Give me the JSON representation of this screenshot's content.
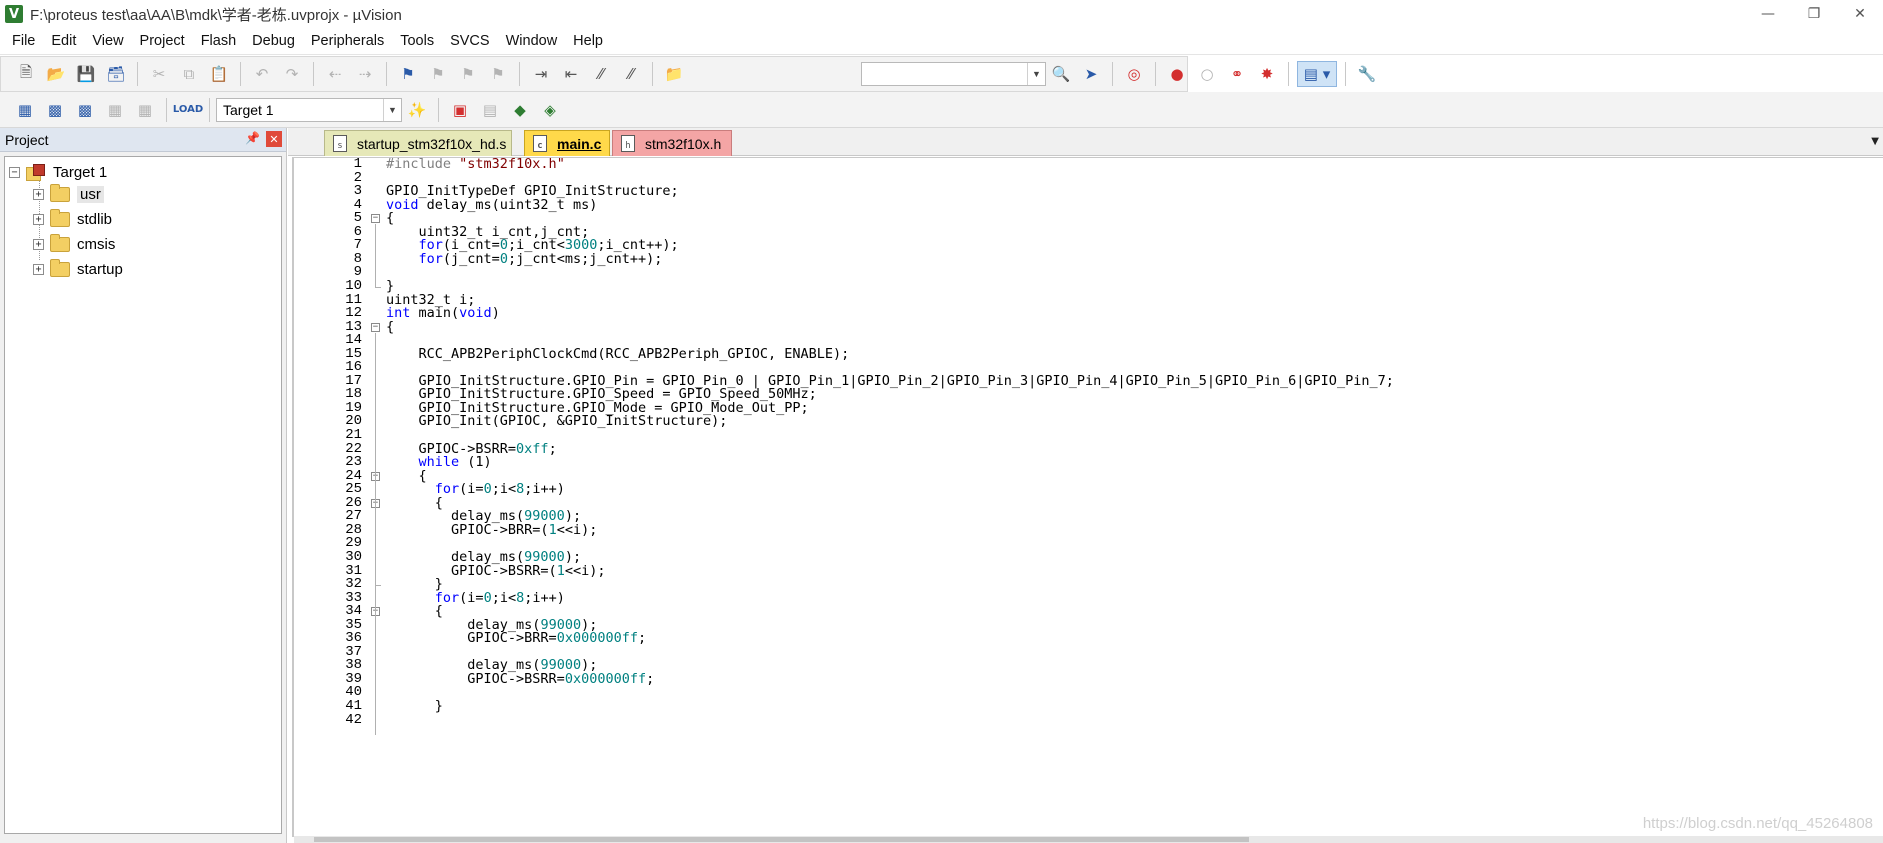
{
  "window": {
    "title": "F:\\proteus test\\aa\\AA\\B\\mdk\\学者-老栋.uvprojx - µVision",
    "app_icon": "V",
    "buttons": [
      "minimize",
      "restore",
      "close"
    ]
  },
  "menu": [
    "File",
    "Edit",
    "View",
    "Project",
    "Flash",
    "Debug",
    "Peripherals",
    "Tools",
    "SVCS",
    "Window",
    "Help"
  ],
  "toolbar": {
    "target_select": "Target 1"
  },
  "project": {
    "header": "Project",
    "target": "Target 1",
    "groups": [
      "usr",
      "stdlib",
      "cmsis",
      "startup"
    ]
  },
  "tabs": [
    {
      "label": "startup_stm32f10x_hd.s",
      "color": "#e6e8b8"
    },
    {
      "label": "main.c",
      "color": "#ffd94a",
      "active": true
    },
    {
      "label": "stm32f10x.h",
      "color": "#f4a5a5"
    }
  ],
  "colors": {
    "keyword": "#0000ff",
    "number": "#008080",
    "string": "#800000",
    "preprocessor": "#808080"
  },
  "code": [
    [
      {
        "t": "#include ",
        "c": "pp"
      },
      {
        "t": "\"stm32f10x.h\"",
        "c": "str"
      }
    ],
    [],
    [
      {
        "t": "GPIO_InitTypeDef GPIO_InitStructure;"
      }
    ],
    [
      {
        "t": "void",
        "c": "kw"
      },
      {
        "t": " delay_ms(uint32_t ms)"
      }
    ],
    [
      {
        "t": "{"
      }
    ],
    [
      {
        "t": "    uint32_t i_cnt,j_cnt;"
      }
    ],
    [
      {
        "t": "    "
      },
      {
        "t": "for",
        "c": "kw"
      },
      {
        "t": "(i_cnt="
      },
      {
        "t": "0",
        "c": "num"
      },
      {
        "t": ";i_cnt<"
      },
      {
        "t": "3000",
        "c": "num"
      },
      {
        "t": ";i_cnt++);"
      }
    ],
    [
      {
        "t": "    "
      },
      {
        "t": "for",
        "c": "kw"
      },
      {
        "t": "(j_cnt="
      },
      {
        "t": "0",
        "c": "num"
      },
      {
        "t": ";j_cnt<ms;j_cnt++);"
      }
    ],
    [],
    [
      {
        "t": "}"
      }
    ],
    [
      {
        "t": "uint32_t i;"
      }
    ],
    [
      {
        "t": "int",
        "c": "kw"
      },
      {
        "t": " main("
      },
      {
        "t": "void",
        "c": "kw"
      },
      {
        "t": ")"
      }
    ],
    [
      {
        "t": "{"
      }
    ],
    [],
    [
      {
        "t": "    RCC_APB2PeriphClockCmd(RCC_APB2Periph_GPIOC, ENABLE);"
      }
    ],
    [],
    [
      {
        "t": "    GPIO_InitStructure.GPIO_Pin = GPIO_Pin_0 | GPIO_Pin_1|GPIO_Pin_2|GPIO_Pin_3|GPIO_Pin_4|GPIO_Pin_5|GPIO_Pin_6|GPIO_Pin_7;"
      }
    ],
    [
      {
        "t": "    GPIO_InitStructure.GPIO_Speed = GPIO_Speed_50MHz;"
      }
    ],
    [
      {
        "t": "    GPIO_InitStructure.GPIO_Mode = GPIO_Mode_Out_PP;"
      }
    ],
    [
      {
        "t": "    GPIO_Init(GPIOC, &GPIO_InitStructure);"
      }
    ],
    [],
    [
      {
        "t": "    GPIOC->BSRR="
      },
      {
        "t": "0xff",
        "c": "num"
      },
      {
        "t": ";"
      }
    ],
    [
      {
        "t": "    "
      },
      {
        "t": "while",
        "c": "kw"
      },
      {
        "t": " (1)"
      }
    ],
    [
      {
        "t": "    {"
      }
    ],
    [
      {
        "t": "      "
      },
      {
        "t": "for",
        "c": "kw"
      },
      {
        "t": "(i="
      },
      {
        "t": "0",
        "c": "num"
      },
      {
        "t": ";i<"
      },
      {
        "t": "8",
        "c": "num"
      },
      {
        "t": ";i++)"
      }
    ],
    [
      {
        "t": "      {"
      }
    ],
    [
      {
        "t": "        delay_ms("
      },
      {
        "t": "99000",
        "c": "num"
      },
      {
        "t": ");"
      }
    ],
    [
      {
        "t": "        GPIOC->BRR=("
      },
      {
        "t": "1",
        "c": "num"
      },
      {
        "t": "<<i);"
      }
    ],
    [],
    [
      {
        "t": "        delay_ms("
      },
      {
        "t": "99000",
        "c": "num"
      },
      {
        "t": ");"
      }
    ],
    [
      {
        "t": "        GPIOC->BSRR=("
      },
      {
        "t": "1",
        "c": "num"
      },
      {
        "t": "<<i);"
      }
    ],
    [
      {
        "t": "      }"
      }
    ],
    [
      {
        "t": "      "
      },
      {
        "t": "for",
        "c": "kw"
      },
      {
        "t": "(i="
      },
      {
        "t": "0",
        "c": "num"
      },
      {
        "t": ";i<"
      },
      {
        "t": "8",
        "c": "num"
      },
      {
        "t": ";i++)"
      }
    ],
    [
      {
        "t": "      {"
      }
    ],
    [
      {
        "t": "          delay_ms("
      },
      {
        "t": "99000",
        "c": "num"
      },
      {
        "t": ");"
      }
    ],
    [
      {
        "t": "          GPIOC->BRR="
      },
      {
        "t": "0x000000ff",
        "c": "num"
      },
      {
        "t": ";"
      }
    ],
    [],
    [
      {
        "t": "          delay_ms("
      },
      {
        "t": "99000",
        "c": "num"
      },
      {
        "t": ");"
      }
    ],
    [
      {
        "t": "          GPIOC->BSRR="
      },
      {
        "t": "0x000000ff",
        "c": "num"
      },
      {
        "t": ";"
      }
    ],
    [],
    [
      {
        "t": "      }"
      }
    ],
    []
  ],
  "fold_markers": [
    5,
    13,
    24,
    26,
    34
  ],
  "fold_ends": [
    10,
    32
  ],
  "watermark": "https://blog.csdn.net/qq_45264808"
}
